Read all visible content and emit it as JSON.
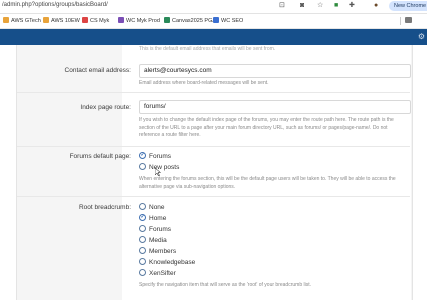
{
  "browser": {
    "url": "/admin.php?options/groups/basicBoard/",
    "new_chrome_label": "New Chrome av",
    "bookmarks": [
      {
        "label": "AWS GTech",
        "color": "#e8a33a"
      },
      {
        "label": "AWS 10EW",
        "color": "#e8a33a"
      },
      {
        "label": "CS Myk",
        "color": "#d44"
      },
      {
        "label": "WC Myk Prod",
        "color": "#7b4fb6"
      },
      {
        "label": "Canvas2025 PGA",
        "color": "#2a8a5a"
      },
      {
        "label": "WC SEO",
        "color": "#3b6fd1"
      }
    ]
  },
  "page": {
    "faded_top_text": "This is the default email address that emails will be sent from.",
    "contact_email": {
      "label": "Contact email address:",
      "value": "alerts@courtesycs.com",
      "hint": "Email address where board-related messages will be sent."
    },
    "index_route": {
      "label": "Index page route:",
      "value": "forums/",
      "hint": "If you wish to change the default index page of the forums, you may enter the route path here. The route path is the section of the URL to a page after your main forum directory URL, such as forums/ or pages/page-name/. Do not reference a route filter here."
    },
    "forums_default": {
      "label": "Forums default page:",
      "options": [
        {
          "label": "Forums",
          "selected": true
        },
        {
          "label": "New posts",
          "selected": false
        }
      ],
      "hint": "When entering the forums section, this will be the default page users will be taken to. They will be able to access the alternative page via sub-navigation options."
    },
    "root_breadcrumb": {
      "label": "Root breadcrumb:",
      "options": [
        {
          "label": "None",
          "selected": false
        },
        {
          "label": "Home",
          "selected": true
        },
        {
          "label": "Forums",
          "selected": false
        },
        {
          "label": "Media",
          "selected": false
        },
        {
          "label": "Members",
          "selected": false
        },
        {
          "label": "Knowledgebase",
          "selected": false
        },
        {
          "label": "XenSifter",
          "selected": false
        }
      ],
      "hint": "Specify the navigation item that will serve as the 'root' of your breadcrumb list."
    }
  },
  "colors": {
    "header_blue": "#164f8a",
    "accent": "#2c65b0"
  }
}
